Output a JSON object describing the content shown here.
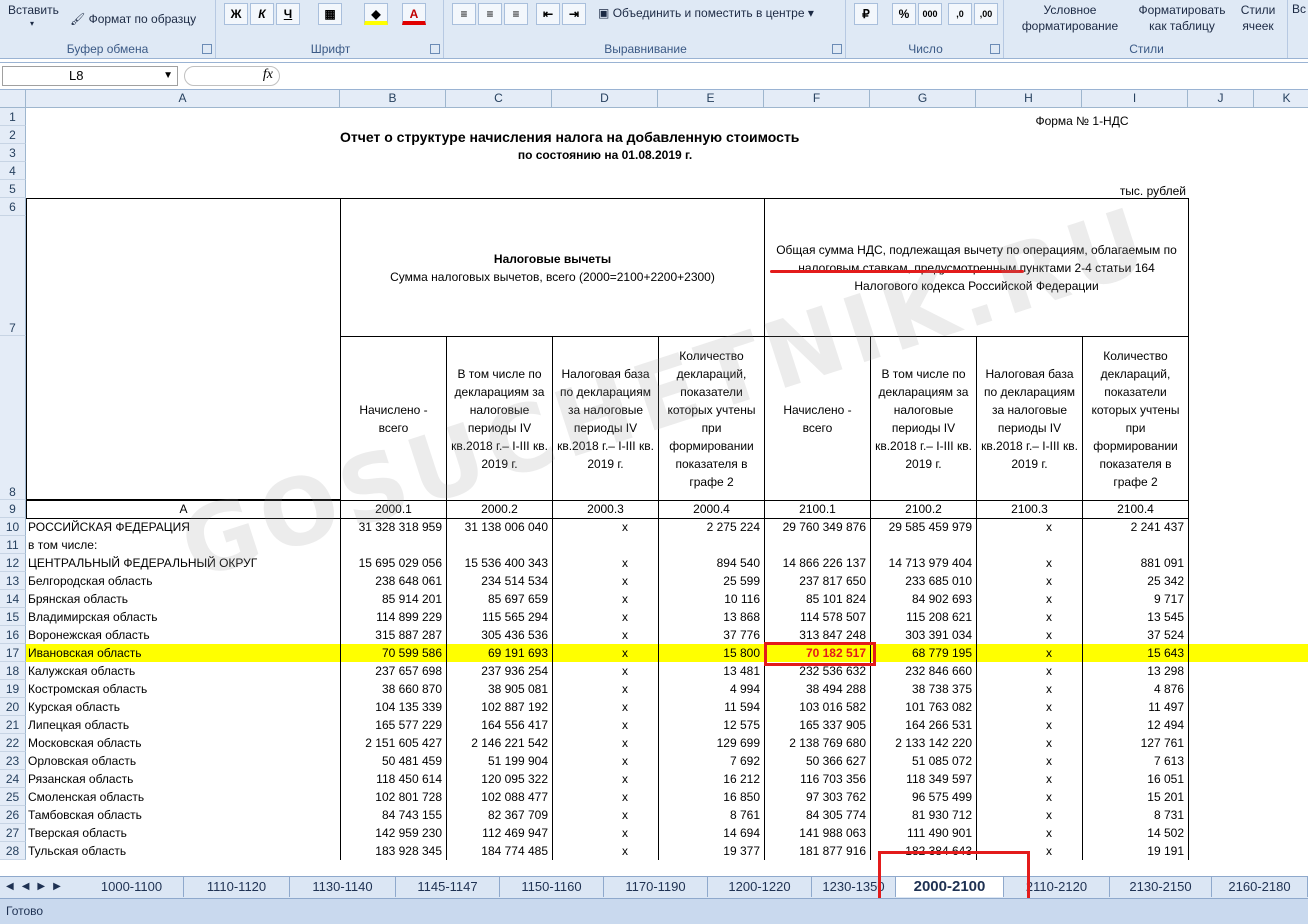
{
  "ribbon": {
    "paste_label": "Вставить",
    "format_painter_label": "Формат по образцу",
    "clipboard_title": "Буфер обмена",
    "font_title": "Шрифт",
    "bold": "Ж",
    "italic": "К",
    "underline": "Ч",
    "font_color_letter": "А",
    "merge_center_label": "Объединить и поместить в центре",
    "alignment_title": "Выравнивание",
    "percent": "%",
    "thousands": "000",
    "number_title": "Число",
    "conditional_label": "Условное форматирование",
    "format_table_label": "Форматировать как таблицу",
    "cell_styles_label": "Стили ячеек",
    "styles_title": "Стили",
    "insert_cut": "Вс"
  },
  "formula_bar": {
    "name_box": "L8",
    "fx": "fx",
    "value": ""
  },
  "columns": [
    "A",
    "B",
    "C",
    "D",
    "E",
    "F",
    "G",
    "H",
    "I",
    "J",
    "K"
  ],
  "rows_numbers": [
    "1",
    "2",
    "3",
    "4",
    "5",
    "6",
    "7",
    "8",
    "9",
    "10",
    "11",
    "12",
    "13",
    "14",
    "15",
    "16",
    "17",
    "18",
    "19",
    "20",
    "21",
    "22",
    "23",
    "24",
    "25",
    "26",
    "27",
    "28"
  ],
  "report": {
    "form_no": "Форма № 1-НДС",
    "title": "Отчет о структуре начисления налога на добавленную стоимость",
    "subtitle": "по состоянию на 01.08.2019 г.",
    "units": "тыс. рублей",
    "group1_title": "Налоговые вычеты",
    "group1_sub": "Сумма налоговых вычетов, всего (2000=2100+2200+2300)",
    "group2_title": "Общая сумма НДС, подлежащая вычету по операциям, облагаемым по налоговым ставкам, предусмотренным пунктами 2-4 статьи 164 Налогового кодекса Российской Федерации",
    "subheaders": [
      "Начислено - всего",
      "В том числе по декларациям за налоговые периоды IV кв.2018 г.– I-III кв. 2019 г.",
      "Налоговая база по декларациям за налоговые периоды IV кв.2018 г.– I-III кв. 2019 г.",
      "Количество деклараций, показатели которых учтены при формировании показателя в графе 2",
      "Начислено - всего",
      "В том числе по декларациям за налоговые периоды IV кв.2018 г.– I-III кв. 2019 г.",
      "Налоговая база по декларациям за налоговые периоды IV кв.2018 г.– I-III кв. 2019 г.",
      "Количество деклараций, показатели которых учтены при формировании показателя в графе 2"
    ],
    "code_row": [
      "A",
      "2000.1",
      "2000.2",
      "2000.3",
      "2000.4",
      "2100.1",
      "2100.2",
      "2100.3",
      "2100.4"
    ]
  },
  "data_rows": [
    {
      "name": "РОССИЙСКАЯ ФЕДЕРАЦИЯ",
      "v": [
        "31 328 318 959",
        "31 138 006 040",
        "x",
        "2 275 224",
        "29 760 349 876",
        "29 585 459 979",
        "x",
        "2 241 437"
      ]
    },
    {
      "name": "    в том числе:",
      "v": [
        "",
        "",
        "",
        "",
        "",
        "",
        "",
        ""
      ]
    },
    {
      "name": "ЦЕНТРАЛЬНЫЙ ФЕДЕРАЛЬНЫЙ ОКРУГ",
      "v": [
        "15 695 029 056",
        "15 536 400 343",
        "x",
        "894 540",
        "14 866 226 137",
        "14 713 979 404",
        "x",
        "881 091"
      ]
    },
    {
      "name": "Белгородская область",
      "v": [
        "238 648 061",
        "234 514 534",
        "x",
        "25 599",
        "237 817 650",
        "233 685 010",
        "x",
        "25 342"
      ]
    },
    {
      "name": "Брянская область",
      "v": [
        "85 914 201",
        "85 697 659",
        "x",
        "10 116",
        "85 101 824",
        "84 902 693",
        "x",
        "9 717"
      ]
    },
    {
      "name": "Владимирская область",
      "v": [
        "114 899 229",
        "115 565 294",
        "x",
        "13 868",
        "114 578 507",
        "115 208 621",
        "x",
        "13 545"
      ]
    },
    {
      "name": "Воронежская область",
      "v": [
        "315 887 287",
        "305 436 536",
        "x",
        "37 776",
        "313 847 248",
        "303 391 034",
        "x",
        "37 524"
      ]
    },
    {
      "name": "Ивановская область",
      "v": [
        "70 599 586",
        "69 191 693",
        "x",
        "15 800",
        "70 182 517",
        "68 779 195",
        "x",
        "15 643"
      ]
    },
    {
      "name": "Калужская область",
      "v": [
        "237 657 698",
        "237 936 254",
        "x",
        "13 481",
        "232 536 632",
        "232 846 660",
        "x",
        "13 298"
      ]
    },
    {
      "name": "Костромская область",
      "v": [
        "38 660 870",
        "38 905 081",
        "x",
        "4 994",
        "38 494 288",
        "38 738 375",
        "x",
        "4 876"
      ]
    },
    {
      "name": "Курская область",
      "v": [
        "104 135 339",
        "102 887 192",
        "x",
        "11 594",
        "103 016 582",
        "101 763 082",
        "x",
        "11 497"
      ]
    },
    {
      "name": "Липецкая область",
      "v": [
        "165 577 229",
        "164 556 417",
        "x",
        "12 575",
        "165 337 905",
        "164 266 531",
        "x",
        "12 494"
      ]
    },
    {
      "name": "Московская область",
      "v": [
        "2 151 605 427",
        "2 146 221 542",
        "x",
        "129 699",
        "2 138 769 680",
        "2 133 142 220",
        "x",
        "127 761"
      ]
    },
    {
      "name": "Орловская область",
      "v": [
        "50 481 459",
        "51 199 904",
        "x",
        "7 692",
        "50 366 627",
        "51 085 072",
        "x",
        "7 613"
      ]
    },
    {
      "name": "Рязанская область",
      "v": [
        "118 450 614",
        "120 095 322",
        "x",
        "16 212",
        "116 703 356",
        "118 349 597",
        "x",
        "16 051"
      ]
    },
    {
      "name": "Смоленская область",
      "v": [
        "102 801 728",
        "102 088 477",
        "x",
        "16 850",
        "97 303 762",
        "96 575 499",
        "x",
        "15 201"
      ]
    },
    {
      "name": "Тамбовская область",
      "v": [
        "84 743 155",
        "82 367 709",
        "x",
        "8 761",
        "84 305 774",
        "81 930 712",
        "x",
        "8 731"
      ]
    },
    {
      "name": "Тверская область",
      "v": [
        "142 959 230",
        "112 469 947",
        "x",
        "14 694",
        "141 988 063",
        "111 490 901",
        "x",
        "14 502"
      ]
    },
    {
      "name": "Тульская область",
      "v": [
        "183 928 345",
        "184 774 485",
        "x",
        "19 377",
        "181 877 916",
        "182 384 643",
        "x",
        "19 191"
      ]
    }
  ],
  "highlight_row_index": 7,
  "sheet_tabs": [
    "1000-1100",
    "1110-1120",
    "1130-1140",
    "1145-1147",
    "1150-1160",
    "1170-1190",
    "1200-1220",
    "1230-1350",
    "2000-2100",
    "2110-2120",
    "2130-2150",
    "2160-2180"
  ],
  "active_tab": "2000-2100",
  "status": "Готово",
  "watermark": "GOSUCHETNIK.RU",
  "colors": {
    "highlight": "#ffff00",
    "annotation": "#e31b1b",
    "ribbon": "#dfe9f5"
  }
}
